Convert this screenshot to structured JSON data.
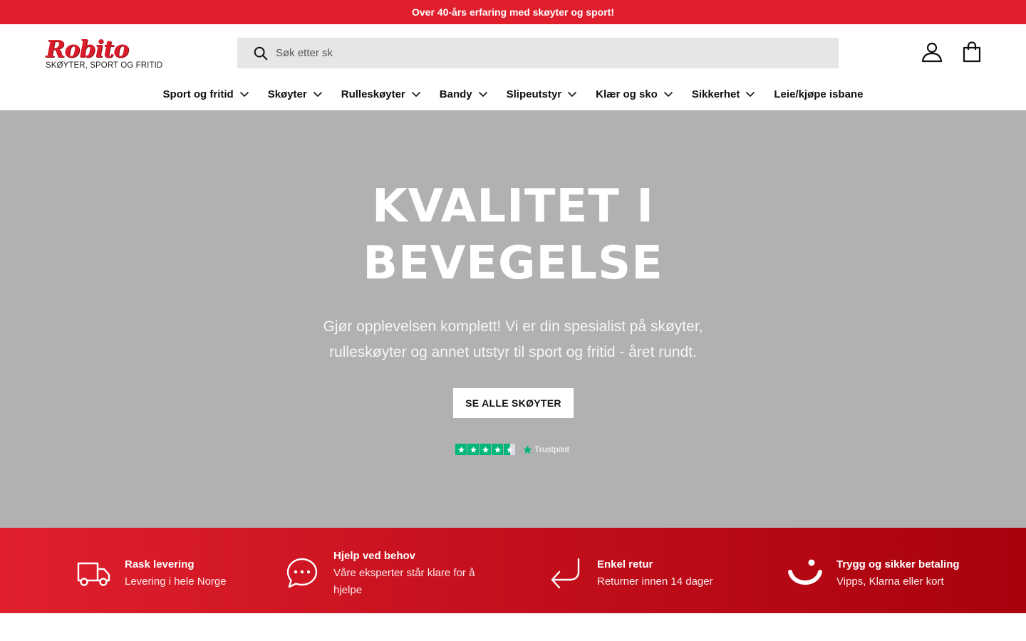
{
  "announcement": {
    "text": "Over 40-års erfaring med skøyter og sport!"
  },
  "header": {
    "logo_word": "Robito",
    "logo_tagline": "SKØYTER, SPORT OG FRITID",
    "search_placeholder": "Søk etter sk",
    "icons": {
      "search": "search-icon",
      "account": "account-icon",
      "cart": "shopping-bag-icon"
    }
  },
  "nav": {
    "items": [
      {
        "label": "Sport og fritid",
        "has_dropdown": true
      },
      {
        "label": "Skøyter",
        "has_dropdown": true
      },
      {
        "label": "Rulleskøyter",
        "has_dropdown": true
      },
      {
        "label": "Bandy",
        "has_dropdown": true
      },
      {
        "label": "Slipeutstyr",
        "has_dropdown": true
      },
      {
        "label": "Klær og sko",
        "has_dropdown": true
      },
      {
        "label": "Sikkerhet",
        "has_dropdown": true
      },
      {
        "label": "Leie/kjøpe isbane",
        "has_dropdown": false
      }
    ]
  },
  "hero": {
    "title": "KVALITET I BEVEGELSE",
    "subtitle": "Gjør opplevelsen komplett! Vi er din spesialist på skøyter, rulleskøyter og annet utstyr til sport og fritid - året rundt.",
    "button_label": "SE ALLE SKØYTER",
    "trustpilot": {
      "label": "Trustpilot",
      "rating_stars": 4.5,
      "max_stars": 5
    }
  },
  "usp": {
    "items": [
      {
        "title": "Rask levering",
        "desc": "Levering i hele Norge",
        "icon": "truck-icon"
      },
      {
        "title": "Hjelp ved behov",
        "desc": "Våre eksperter står klare for å hjelpe",
        "icon": "chat-icon"
      },
      {
        "title": "Enkel retur",
        "desc": "Returner innen 14 dager",
        "icon": "return-arrow-icon"
      },
      {
        "title": "Trygg og sikker betaling",
        "desc": "Vipps, Klarna eller kort",
        "icon": "smile-icon"
      }
    ]
  },
  "colors": {
    "brand_red": "#e01f2d",
    "hero_bg": "#b1b1b1",
    "trustpilot_green": "#00b67a"
  }
}
